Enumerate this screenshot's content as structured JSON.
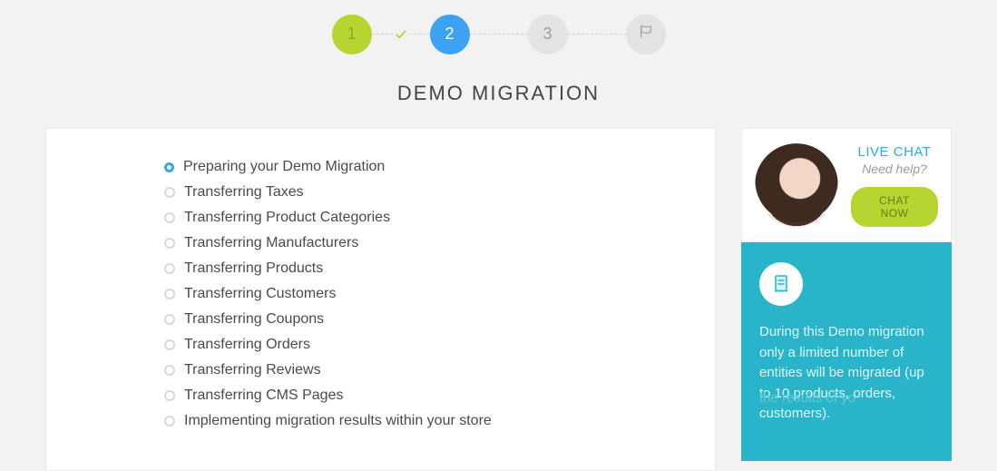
{
  "stepper": {
    "steps": [
      "1",
      "2",
      "3"
    ],
    "activeIndex": 1,
    "doneIndex": 0
  },
  "title": "DEMO MIGRATION",
  "progress": {
    "activeIndex": 0,
    "items": [
      "Preparing your Demo Migration",
      "Transferring Taxes",
      "Transferring Product Categories",
      "Transferring Manufacturers",
      "Transferring Products",
      "Transferring Customers",
      "Transferring Coupons",
      "Transferring Orders",
      "Transferring Reviews",
      "Transferring CMS Pages",
      "Implementing migration results within your store"
    ]
  },
  "chat": {
    "title": "LIVE CHAT",
    "subtitle": "Need help?",
    "button": "CHAT NOW"
  },
  "info": {
    "text": "During this Demo migration only a limited number of entities will be migrated (up to 10 products, orders, customers).",
    "faded": "the results of yo"
  }
}
